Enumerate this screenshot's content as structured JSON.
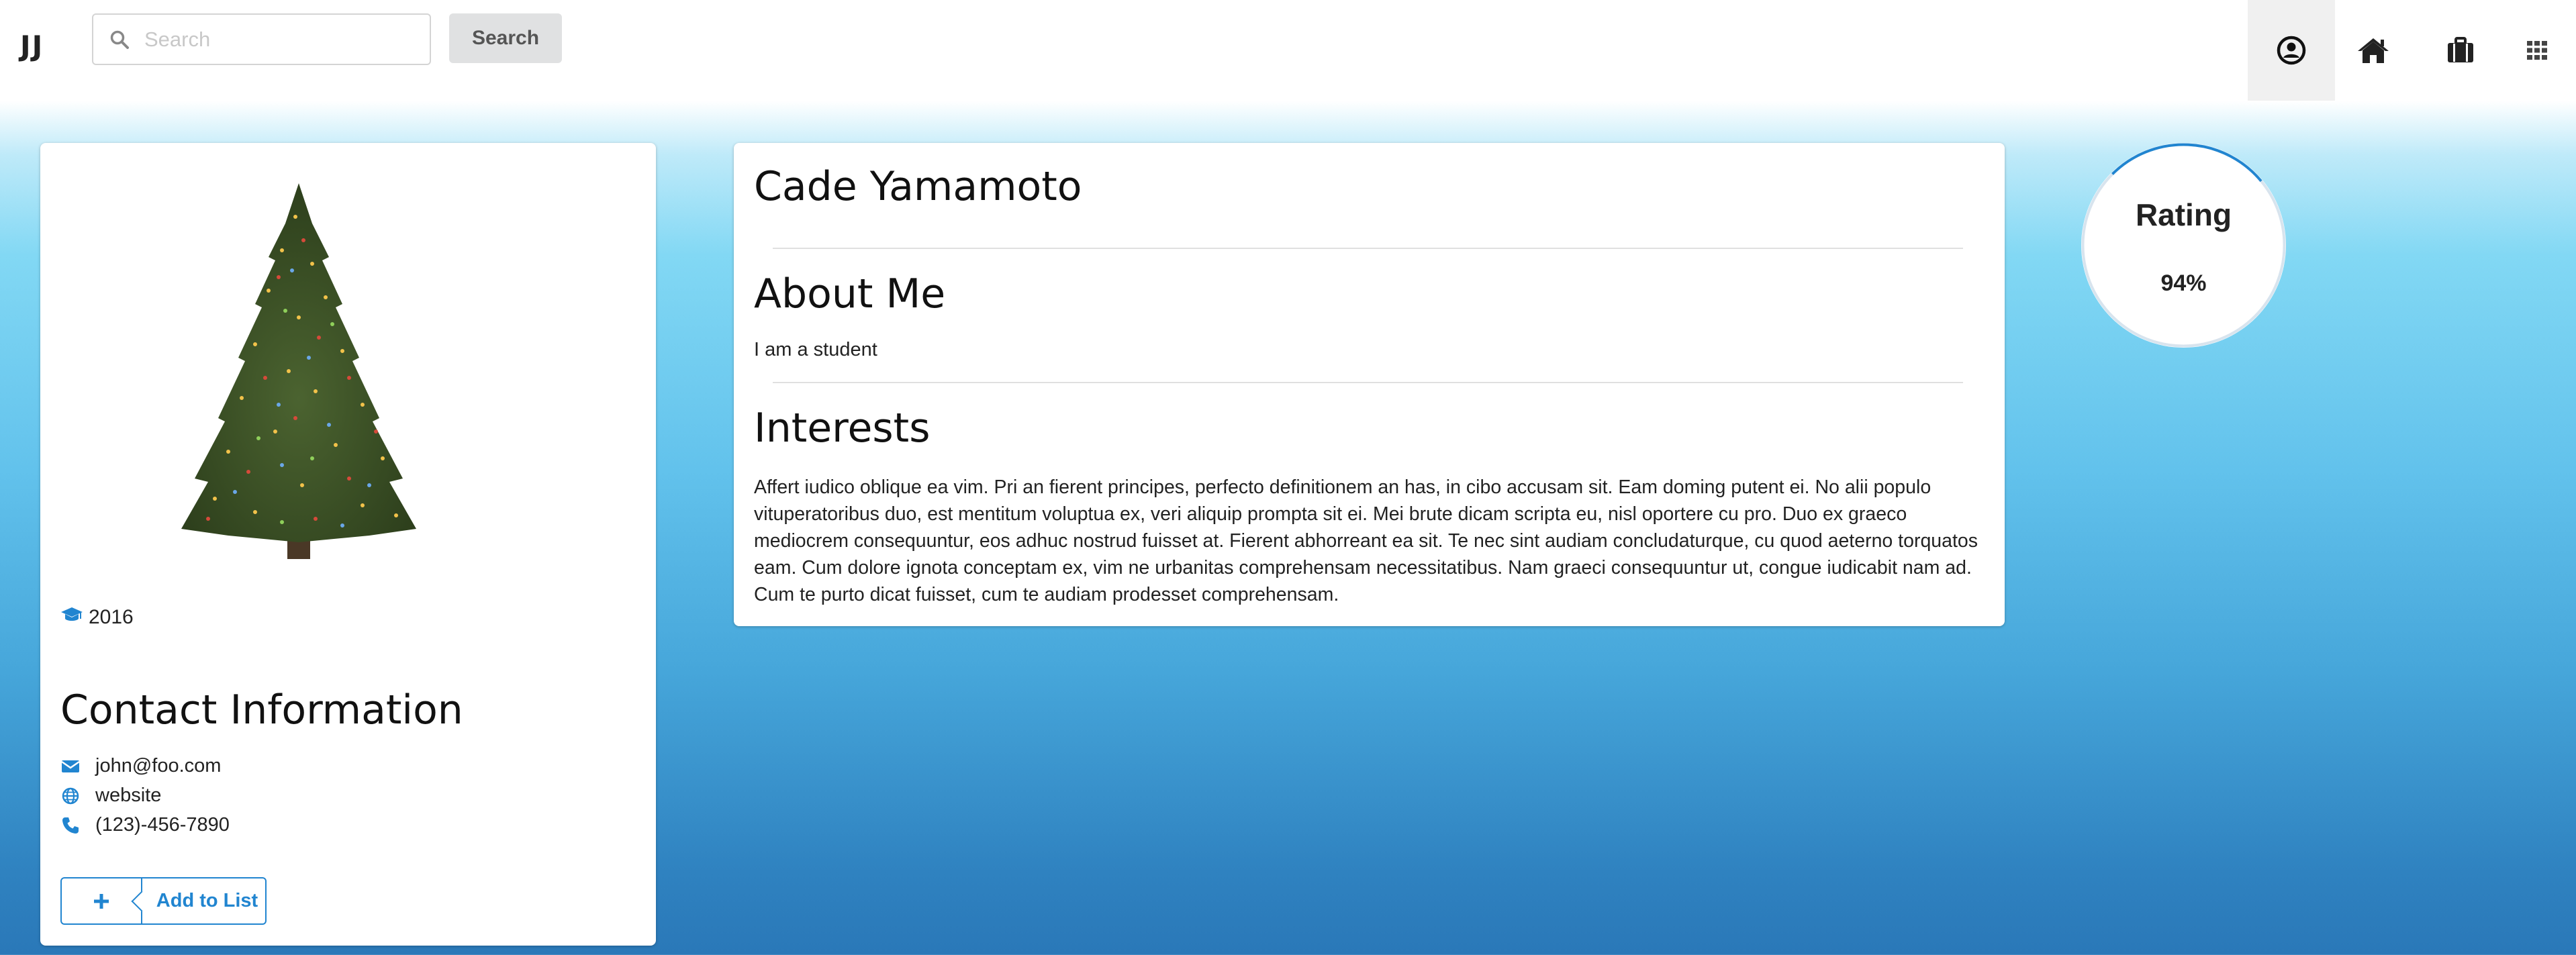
{
  "nav": {
    "brand": "JJ",
    "search_placeholder": "Search",
    "search_button": "Search"
  },
  "profile": {
    "graduation_year": "2016",
    "contact_title": "Contact Information",
    "email": "john@foo.com",
    "website": "website",
    "phone": "(123)-456-7890",
    "add_to_list": "Add to List"
  },
  "about": {
    "name": "Cade Yamamoto",
    "about_title": "About Me",
    "about_text": "I am a student",
    "interests_title": "Interests",
    "interests_text": "Affert iudico oblique ea vim. Pri an fierent principes, perfecto definitionem an has, in cibo accusam sit. Eam doming putent ei. No alii populo vituperatoribus duo, est mentitum voluptua ex, veri aliquip prompta sit ei. Mei brute dicam scripta eu, nisl oportere cu pro. Duo ex graeco mediocrem consequuntur, eos adhuc nostrud fuisset at. Fierent abhorreant ea sit. Te nec sint audiam concludaturque, cu quod aeterno torquatos eam. Cum dolore ignota conceptam ex, vim ne urbanitas comprehensam necessitatibus. Nam graeci consequuntur ut, congue iudicabit nam ad. Cum te purto dicat fuisset, cum te audiam prodesset comprehensam."
  },
  "rating": {
    "title": "Rating",
    "value": "94%",
    "fraction": 0.94
  },
  "colors": {
    "accent": "#2185d0",
    "ring": "#d8e4ee"
  }
}
